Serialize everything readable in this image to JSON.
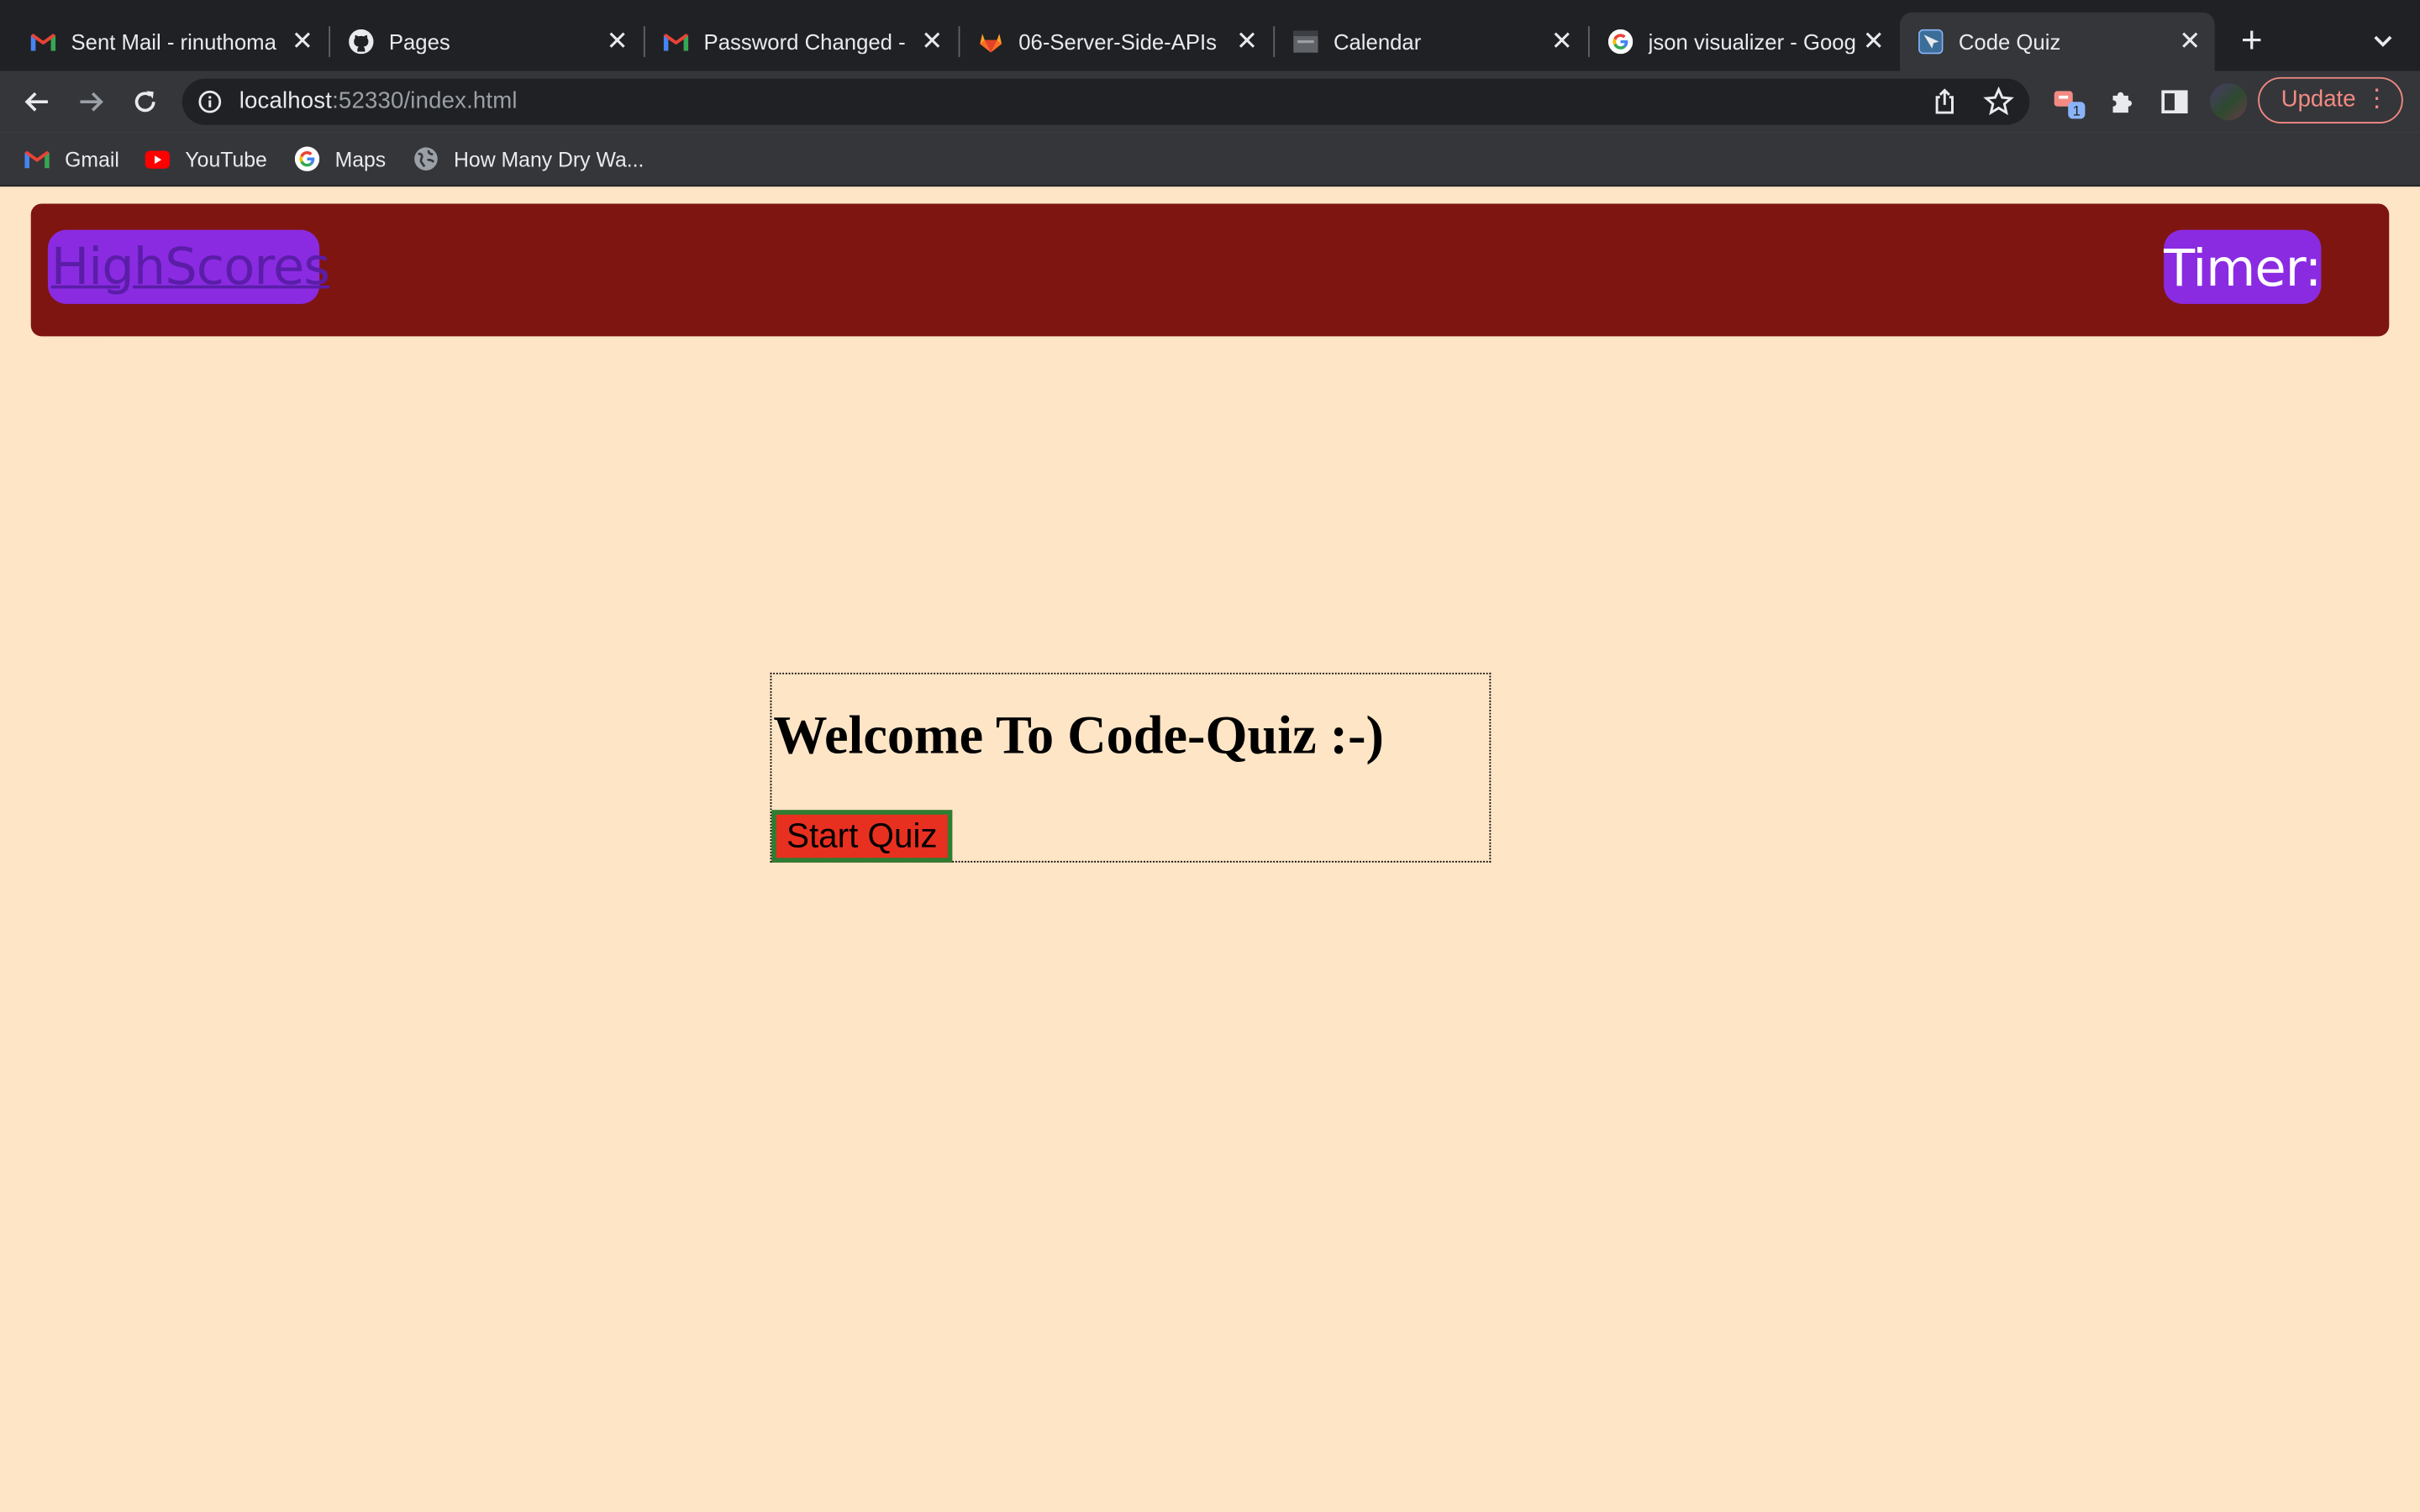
{
  "browser": {
    "tabs": [
      {
        "title": "Sent Mail - rinuthoma",
        "icon": "gmail-icon"
      },
      {
        "title": "Pages",
        "icon": "github-icon"
      },
      {
        "title": "Password Changed -",
        "icon": "gmail-icon"
      },
      {
        "title": "06-Server-Side-APIs",
        "icon": "gitlab-icon"
      },
      {
        "title": "Calendar",
        "icon": "calendar-icon"
      },
      {
        "title": "json visualizer - Goog",
        "icon": "google-icon"
      },
      {
        "title": "Code Quiz",
        "icon": "page-icon",
        "active": true
      }
    ],
    "address": {
      "host": "localhost",
      "rest": ":52330/index.html"
    },
    "update_label": "Update",
    "extension_badge": "1",
    "bookmarks": [
      {
        "label": "Gmail",
        "icon": "gmail-icon"
      },
      {
        "label": "YouTube",
        "icon": "youtube-icon"
      },
      {
        "label": "Maps",
        "icon": "google-icon"
      },
      {
        "label": "How Many Dry Wa...",
        "icon": "globe-icon"
      }
    ]
  },
  "page": {
    "highscores_label": "HighScores",
    "timer_label": "Timer:",
    "welcome_heading": "Welcome To Code-Quiz :-)",
    "start_button_label": "Start Quiz"
  },
  "colors": {
    "page_background": "#fde5c6",
    "header_background": "#7f1510",
    "header_button": "#8a2be2",
    "start_button": "#e83020",
    "start_button_border": "#2e7d32"
  }
}
